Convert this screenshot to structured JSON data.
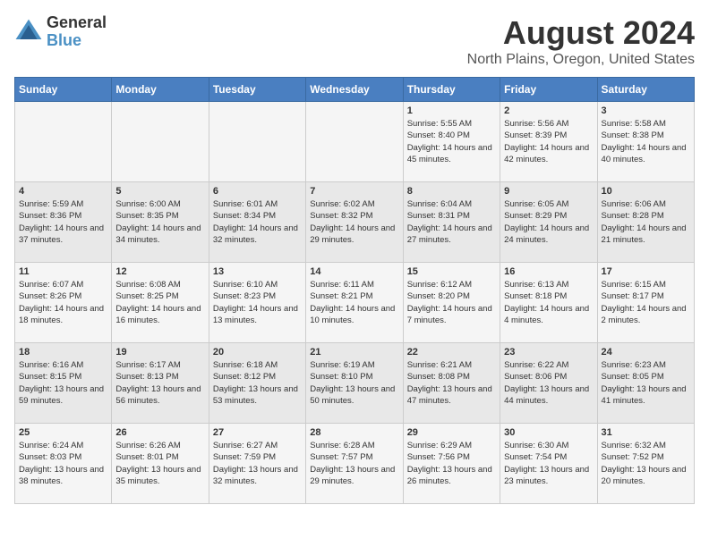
{
  "header": {
    "logo_general": "General",
    "logo_blue": "Blue",
    "main_title": "August 2024",
    "subtitle": "North Plains, Oregon, United States"
  },
  "days_of_week": [
    "Sunday",
    "Monday",
    "Tuesday",
    "Wednesday",
    "Thursday",
    "Friday",
    "Saturday"
  ],
  "weeks": [
    [
      {
        "day": "",
        "info": ""
      },
      {
        "day": "",
        "info": ""
      },
      {
        "day": "",
        "info": ""
      },
      {
        "day": "",
        "info": ""
      },
      {
        "day": "1",
        "info": "Sunrise: 5:55 AM\nSunset: 8:40 PM\nDaylight: 14 hours and 45 minutes."
      },
      {
        "day": "2",
        "info": "Sunrise: 5:56 AM\nSunset: 8:39 PM\nDaylight: 14 hours and 42 minutes."
      },
      {
        "day": "3",
        "info": "Sunrise: 5:58 AM\nSunset: 8:38 PM\nDaylight: 14 hours and 40 minutes."
      }
    ],
    [
      {
        "day": "4",
        "info": "Sunrise: 5:59 AM\nSunset: 8:36 PM\nDaylight: 14 hours and 37 minutes."
      },
      {
        "day": "5",
        "info": "Sunrise: 6:00 AM\nSunset: 8:35 PM\nDaylight: 14 hours and 34 minutes."
      },
      {
        "day": "6",
        "info": "Sunrise: 6:01 AM\nSunset: 8:34 PM\nDaylight: 14 hours and 32 minutes."
      },
      {
        "day": "7",
        "info": "Sunrise: 6:02 AM\nSunset: 8:32 PM\nDaylight: 14 hours and 29 minutes."
      },
      {
        "day": "8",
        "info": "Sunrise: 6:04 AM\nSunset: 8:31 PM\nDaylight: 14 hours and 27 minutes."
      },
      {
        "day": "9",
        "info": "Sunrise: 6:05 AM\nSunset: 8:29 PM\nDaylight: 14 hours and 24 minutes."
      },
      {
        "day": "10",
        "info": "Sunrise: 6:06 AM\nSunset: 8:28 PM\nDaylight: 14 hours and 21 minutes."
      }
    ],
    [
      {
        "day": "11",
        "info": "Sunrise: 6:07 AM\nSunset: 8:26 PM\nDaylight: 14 hours and 18 minutes."
      },
      {
        "day": "12",
        "info": "Sunrise: 6:08 AM\nSunset: 8:25 PM\nDaylight: 14 hours and 16 minutes."
      },
      {
        "day": "13",
        "info": "Sunrise: 6:10 AM\nSunset: 8:23 PM\nDaylight: 14 hours and 13 minutes."
      },
      {
        "day": "14",
        "info": "Sunrise: 6:11 AM\nSunset: 8:21 PM\nDaylight: 14 hours and 10 minutes."
      },
      {
        "day": "15",
        "info": "Sunrise: 6:12 AM\nSunset: 8:20 PM\nDaylight: 14 hours and 7 minutes."
      },
      {
        "day": "16",
        "info": "Sunrise: 6:13 AM\nSunset: 8:18 PM\nDaylight: 14 hours and 4 minutes."
      },
      {
        "day": "17",
        "info": "Sunrise: 6:15 AM\nSunset: 8:17 PM\nDaylight: 14 hours and 2 minutes."
      }
    ],
    [
      {
        "day": "18",
        "info": "Sunrise: 6:16 AM\nSunset: 8:15 PM\nDaylight: 13 hours and 59 minutes."
      },
      {
        "day": "19",
        "info": "Sunrise: 6:17 AM\nSunset: 8:13 PM\nDaylight: 13 hours and 56 minutes."
      },
      {
        "day": "20",
        "info": "Sunrise: 6:18 AM\nSunset: 8:12 PM\nDaylight: 13 hours and 53 minutes."
      },
      {
        "day": "21",
        "info": "Sunrise: 6:19 AM\nSunset: 8:10 PM\nDaylight: 13 hours and 50 minutes."
      },
      {
        "day": "22",
        "info": "Sunrise: 6:21 AM\nSunset: 8:08 PM\nDaylight: 13 hours and 47 minutes."
      },
      {
        "day": "23",
        "info": "Sunrise: 6:22 AM\nSunset: 8:06 PM\nDaylight: 13 hours and 44 minutes."
      },
      {
        "day": "24",
        "info": "Sunrise: 6:23 AM\nSunset: 8:05 PM\nDaylight: 13 hours and 41 minutes."
      }
    ],
    [
      {
        "day": "25",
        "info": "Sunrise: 6:24 AM\nSunset: 8:03 PM\nDaylight: 13 hours and 38 minutes."
      },
      {
        "day": "26",
        "info": "Sunrise: 6:26 AM\nSunset: 8:01 PM\nDaylight: 13 hours and 35 minutes."
      },
      {
        "day": "27",
        "info": "Sunrise: 6:27 AM\nSunset: 7:59 PM\nDaylight: 13 hours and 32 minutes."
      },
      {
        "day": "28",
        "info": "Sunrise: 6:28 AM\nSunset: 7:57 PM\nDaylight: 13 hours and 29 minutes."
      },
      {
        "day": "29",
        "info": "Sunrise: 6:29 AM\nSunset: 7:56 PM\nDaylight: 13 hours and 26 minutes."
      },
      {
        "day": "30",
        "info": "Sunrise: 6:30 AM\nSunset: 7:54 PM\nDaylight: 13 hours and 23 minutes."
      },
      {
        "day": "31",
        "info": "Sunrise: 6:32 AM\nSunset: 7:52 PM\nDaylight: 13 hours and 20 minutes."
      }
    ]
  ]
}
